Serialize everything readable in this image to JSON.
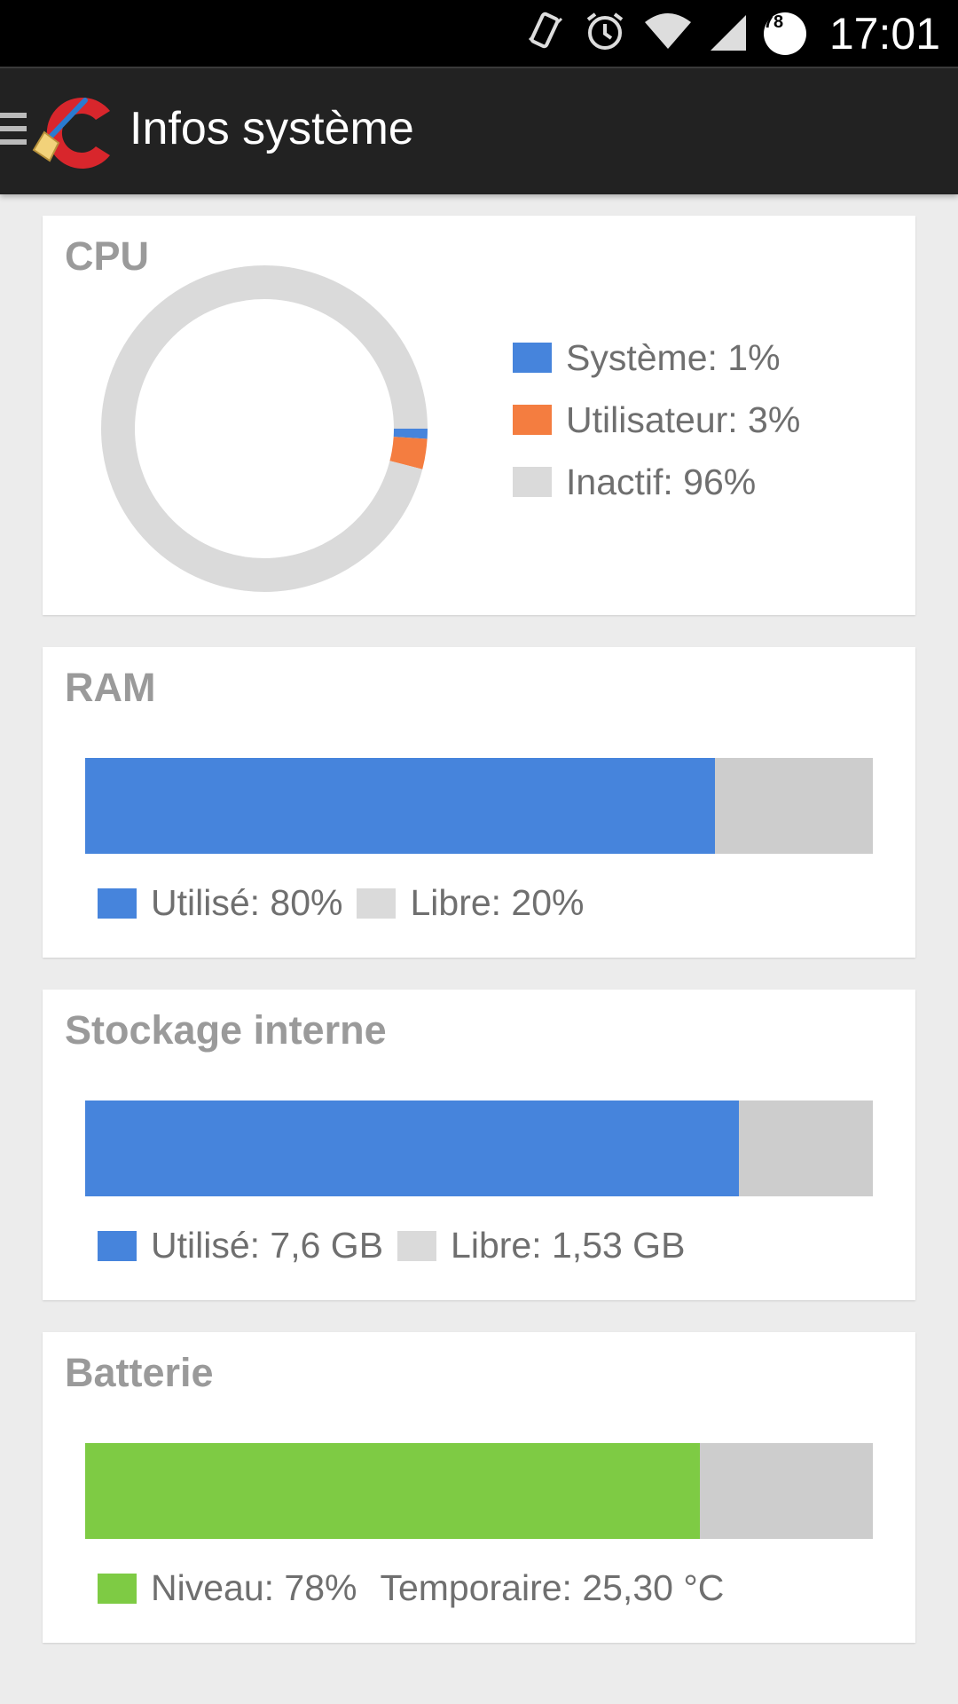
{
  "status_bar": {
    "time": "17:01",
    "battery_level": "78",
    "icons": [
      "vibrate-icon",
      "alarm-icon",
      "wifi-icon",
      "signal-icon",
      "battery-icon"
    ]
  },
  "action_bar": {
    "title": "Infos système",
    "menu_icon": "hamburger-menu-icon",
    "logo_icon": "ccleaner-logo-icon"
  },
  "colors": {
    "blue": "#4684DC",
    "orange": "#F47D40",
    "gray": "#DADADA",
    "green": "#7ECB44",
    "track": "#CDCDCD"
  },
  "cpu": {
    "title": "CPU",
    "legend": [
      {
        "label": "Système: 1%",
        "percent": 1,
        "color": "#4684DC"
      },
      {
        "label": "Utilisateur: 3%",
        "percent": 3,
        "color": "#F47D40"
      },
      {
        "label": "Inactif: 96%",
        "percent": 96,
        "color": "#DADADA"
      }
    ]
  },
  "ram": {
    "title": "RAM",
    "used_fraction": 0.8,
    "used_label": "Utilisé: 80%",
    "free_label": "Libre: 20%"
  },
  "storage": {
    "title": "Stockage interne",
    "used_fraction": 0.83,
    "used_label": "Utilisé: 7,6 GB",
    "free_label": "Libre: 1,53 GB"
  },
  "battery": {
    "title": "Batterie",
    "level_fraction": 0.78,
    "level_label": "Niveau: 78%",
    "temp_label": "Temporaire: 25,30 °C"
  }
}
